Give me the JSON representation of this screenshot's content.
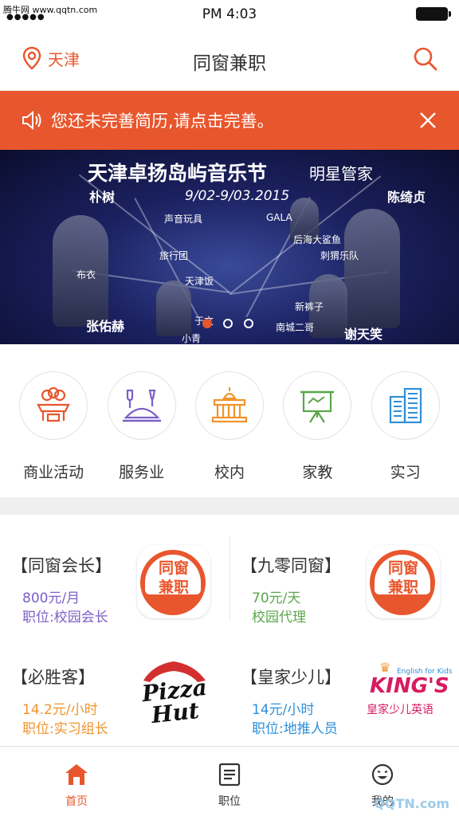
{
  "status": {
    "carrier": "腾牛网 www.qqtn.com",
    "time": "PM 4:03"
  },
  "header": {
    "location": "天津",
    "title": "同窗兼职"
  },
  "notice": {
    "text": "您还未完善简历,请点击完善。"
  },
  "banner": {
    "title": "天津卓扬岛屿音乐节",
    "subtitle": "明星管家",
    "date": "9/02-9/03.2015",
    "labels": [
      "朴树",
      "声音玩具",
      "GALA",
      "陈绮贞",
      "布衣",
      "旅行团",
      "刺猬乐队",
      "天津饭",
      "张佑赫",
      "于文",
      "小青",
      "谢天笑",
      "南城二哥",
      "后海大鲨鱼",
      "新裤子"
    ],
    "active_slide": 1
  },
  "categories": [
    {
      "label": "商业活动",
      "icon": "business-activity-icon",
      "color": "#e8562d"
    },
    {
      "label": "服务业",
      "icon": "service-icon",
      "color": "#7b5fc7"
    },
    {
      "label": "校内",
      "icon": "campus-icon",
      "color": "#f0932b"
    },
    {
      "label": "家教",
      "icon": "tutor-icon",
      "color": "#5aa64a"
    },
    {
      "label": "实习",
      "icon": "internship-icon",
      "color": "#2f8fd8"
    }
  ],
  "jobs": [
    {
      "company": "【同窗会长】",
      "pay": "800元/月",
      "position": "职位:校园会长",
      "color": "#7b5fc7",
      "logo_line1": "同窗",
      "logo_line2": "兼职"
    },
    {
      "company": "【九零同窗】",
      "pay": "70元/天",
      "position": "校园代理",
      "color": "#5aa64a",
      "logo_line1": "同窗",
      "logo_line2": "兼职"
    },
    {
      "company": "【必胜客】",
      "pay": "14.2元/小时",
      "position": "职位:实习组长",
      "color": "#f0932b",
      "logo_line1": "Pizza",
      "logo_line2": "Hut"
    },
    {
      "company": "【皇家少儿】",
      "pay": "14元/小时",
      "position": "职位:地推人员",
      "color": "#2f8fd8",
      "logo_top": "English for Kids",
      "logo_brand": "KING'S",
      "logo_line1": "皇家少儿英语"
    }
  ],
  "tabs": [
    {
      "label": "首页",
      "icon": "home-icon",
      "active": true
    },
    {
      "label": "职位",
      "icon": "list-icon",
      "active": false
    },
    {
      "label": "我的",
      "icon": "smiley-icon",
      "active": false
    }
  ],
  "watermark": "QQTN.com"
}
